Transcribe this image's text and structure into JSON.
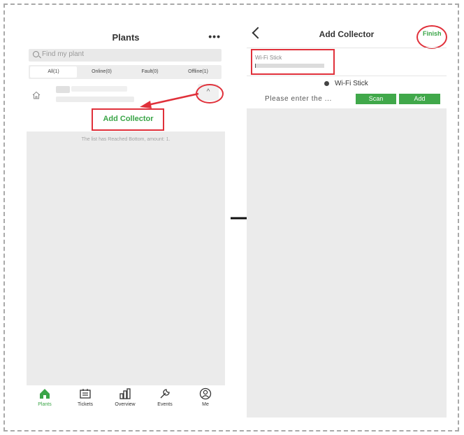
{
  "left": {
    "title": "Plants",
    "more": "•••",
    "search_placeholder": "Find my plant",
    "tabs": [
      {
        "label": "All(1)"
      },
      {
        "label": "Online(0)"
      },
      {
        "label": "Fault(0)"
      },
      {
        "label": "Offline(1)"
      }
    ],
    "expand_icon": "^",
    "add_collector": "Add Collector",
    "list_end": "The list has Reached Bottom, amount: 1.",
    "nav": [
      {
        "label": "Plants",
        "icon": "home-icon"
      },
      {
        "label": "Tickets",
        "icon": "ticket-icon"
      },
      {
        "label": "Overview",
        "icon": "chart-icon"
      },
      {
        "label": "Events",
        "icon": "wrench-icon"
      },
      {
        "label": "Me",
        "icon": "user-icon"
      }
    ]
  },
  "right": {
    "title": "Add Collector",
    "finish": "Finish",
    "wifi_label": "Wi-Fi Stick",
    "radio_label": "Wi-Fi Stick",
    "enter_label": "Please enter the ...",
    "scan": "Scan",
    "add": "Add"
  },
  "colors": {
    "accent_green": "#3aa547",
    "highlight_red": "#e0303a",
    "background_gray": "#ebebeb"
  }
}
